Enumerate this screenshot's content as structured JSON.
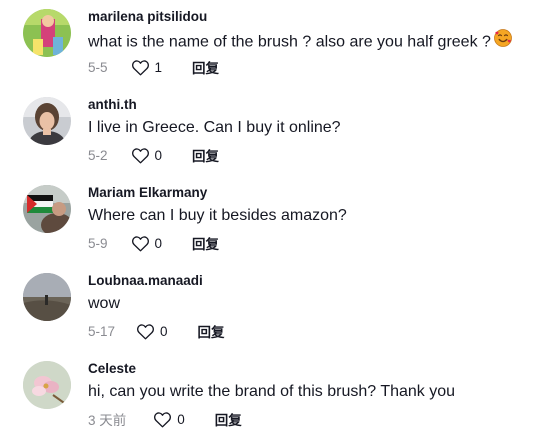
{
  "comments": [
    {
      "username": "marilena pitsilidou",
      "text": "what is the name of the brush ? also are you half greek ?",
      "emoji_icon": "smiling-face-with-hearts-emoji",
      "date": "5-5",
      "likes": "1",
      "reply_label": "回复"
    },
    {
      "username": "anthi.th",
      "text": "I live in Greece. Can I buy it online?",
      "date": "5-2",
      "likes": "0",
      "reply_label": "回复"
    },
    {
      "username": "Mariam Elkarmany",
      "text": "Where can I buy it besides amazon?",
      "date": "5-9",
      "likes": "0",
      "reply_label": "回复"
    },
    {
      "username": "Loubnaa.manaadi",
      "text": "wow",
      "date": "5-17",
      "likes": "0",
      "reply_label": "回复"
    },
    {
      "username": "Celeste",
      "text": "hi, can you write the brand of this brush? Thank you",
      "date": "3 天前",
      "likes": "0",
      "reply_label": "回复"
    }
  ],
  "colors": {
    "text_primary": "#161823",
    "text_secondary": "#8a8b91",
    "background": "#ffffff"
  }
}
